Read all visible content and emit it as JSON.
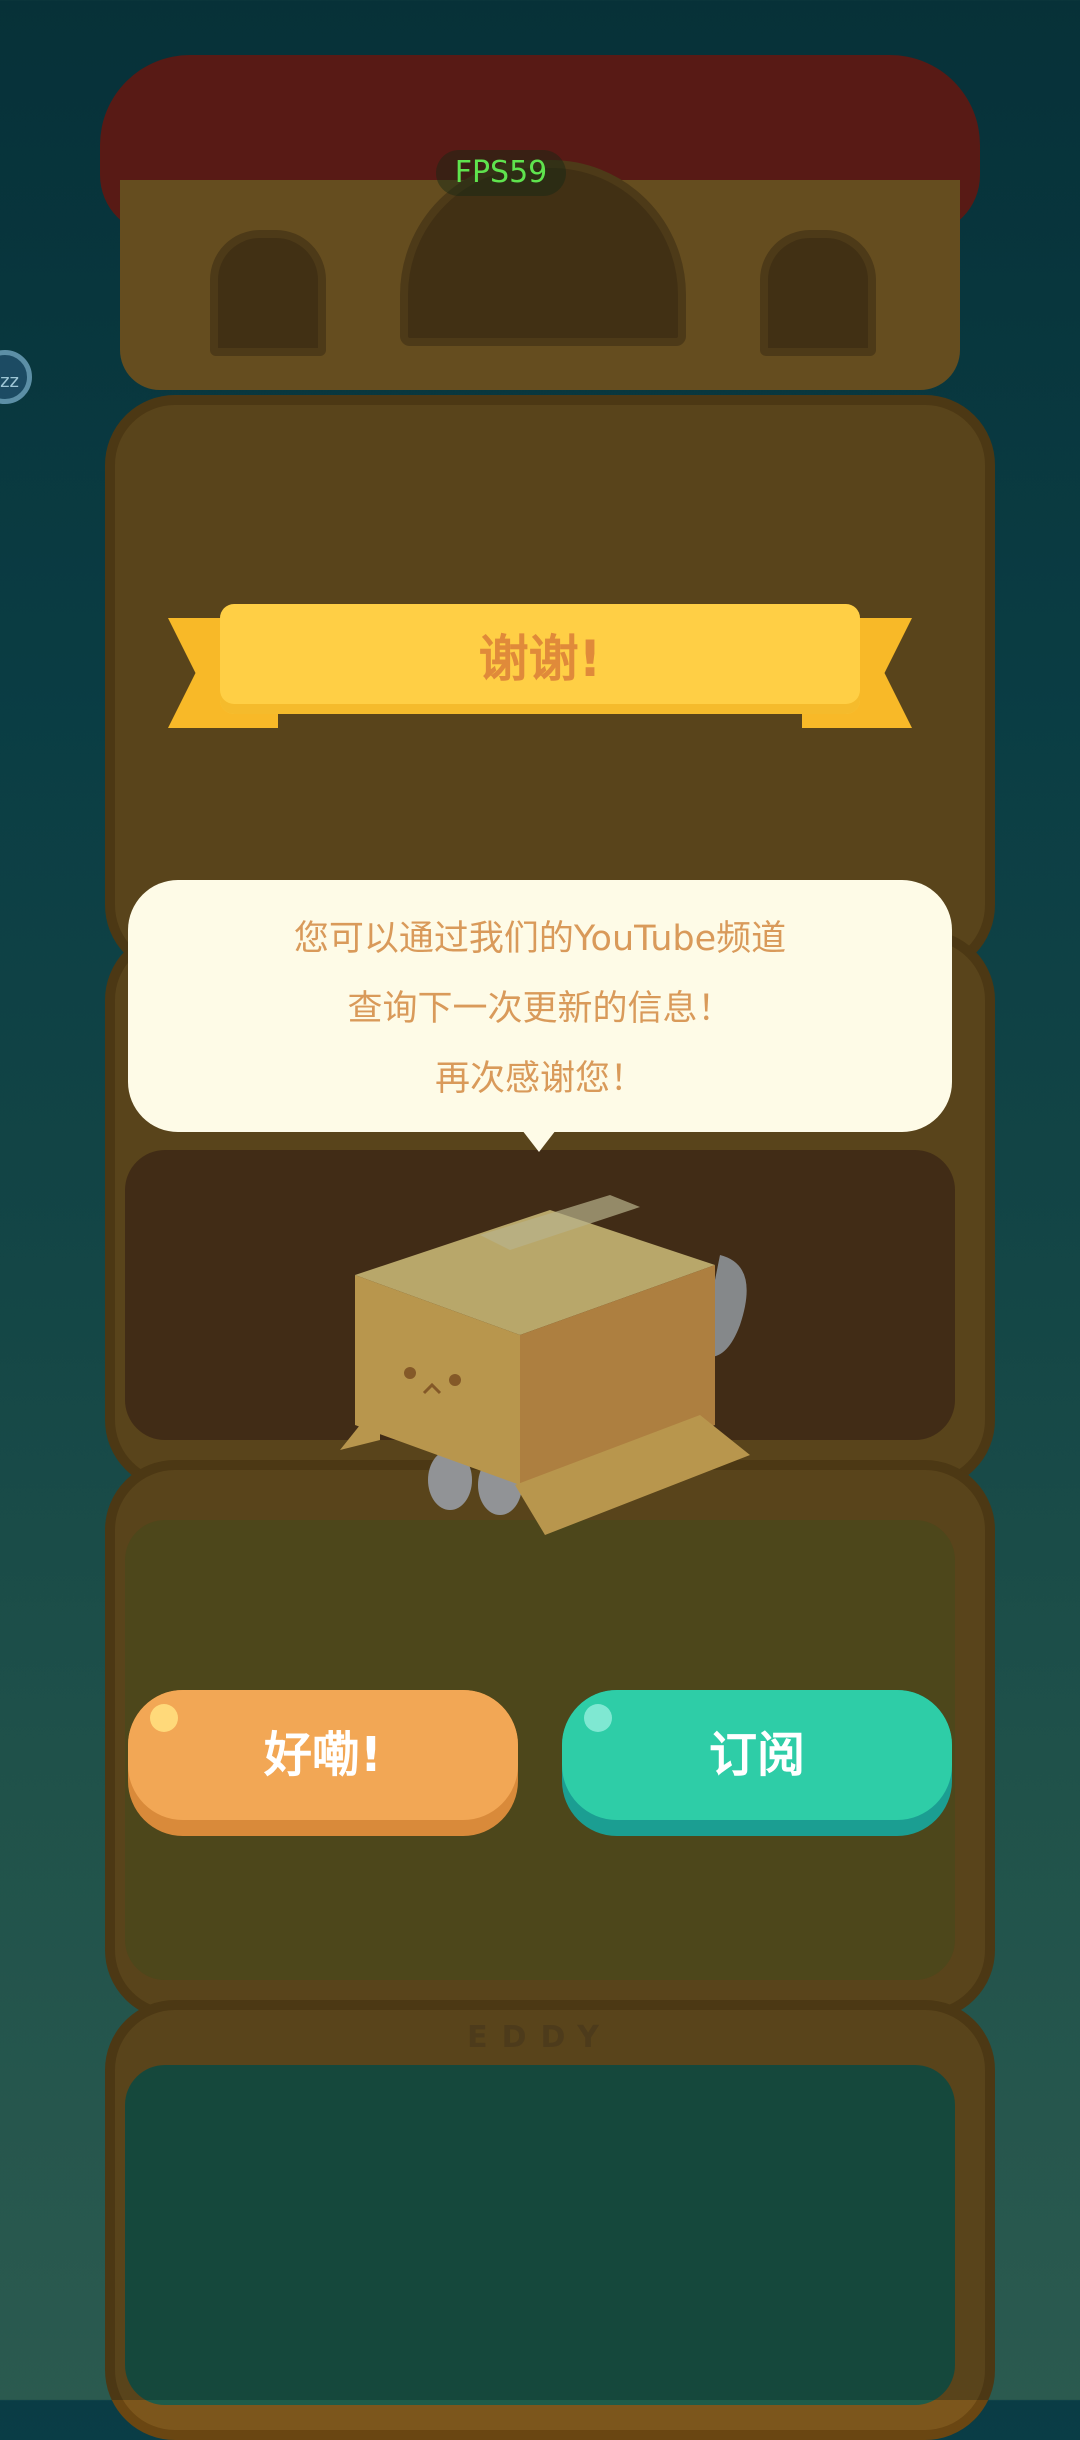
{
  "hud": {
    "fps": "FPS59",
    "sleep_badge": "zz"
  },
  "dialog": {
    "title": "谢谢!",
    "message_lines": [
      "您可以通过我们的YouTube频道",
      "查询下一次更新的信息！",
      "再次感谢您！"
    ]
  },
  "buttons": {
    "ok_label": "好嘞!",
    "subscribe_label": "订阅"
  },
  "house": {
    "room_sign": "EDDY"
  },
  "colors": {
    "ribbon": "#ffcf45",
    "title_text": "#e08a3a",
    "bubble": "#fefbe7",
    "ok_button": "#f2a755",
    "subscribe_button": "#2ecda7"
  }
}
